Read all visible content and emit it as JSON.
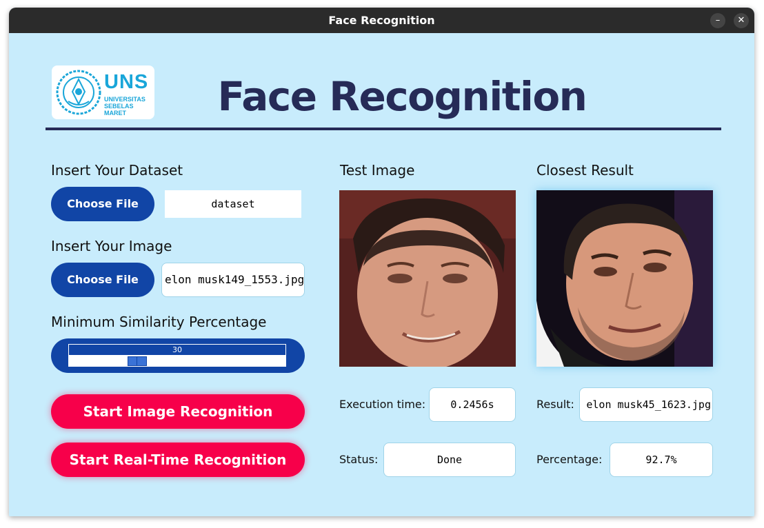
{
  "window": {
    "title": "Face Recognition",
    "minimize_glyph": "–",
    "close_glyph": "✕"
  },
  "logo": {
    "mark": "UNS",
    "line1": "UNIVERSITAS",
    "line2": "SEBELAS MARET"
  },
  "header": {
    "title": "Face Recognition"
  },
  "dataset": {
    "label": "Insert Your Dataset",
    "button": "Choose File",
    "value": "dataset"
  },
  "image": {
    "label": "Insert Your Image",
    "button": "Choose File",
    "value": "elon musk149_1553.jpg"
  },
  "similarity": {
    "label": "Minimum Similarity Percentage",
    "value": "30",
    "min": 0,
    "max": 100
  },
  "actions": {
    "start_image": "Start Image Recognition",
    "start_realtime": "Start Real-Time Recognition"
  },
  "test_image": {
    "label": "Test Image"
  },
  "closest_result": {
    "label": "Closest Result"
  },
  "stats": {
    "execution_label": "Execution time:",
    "execution_value": "0.2456s",
    "status_label": "Status:",
    "status_value": "Done",
    "result_label": "Result:",
    "result_value": "elon musk45_1623.jpg",
    "percentage_label": "Percentage:",
    "percentage_value": "92.7%"
  },
  "colors": {
    "background": "#c8ecfc",
    "primary_blue": "#1145a6",
    "accent_red": "#f7004a",
    "title_navy": "#262b57",
    "logo_cyan": "#1aa6d9"
  }
}
